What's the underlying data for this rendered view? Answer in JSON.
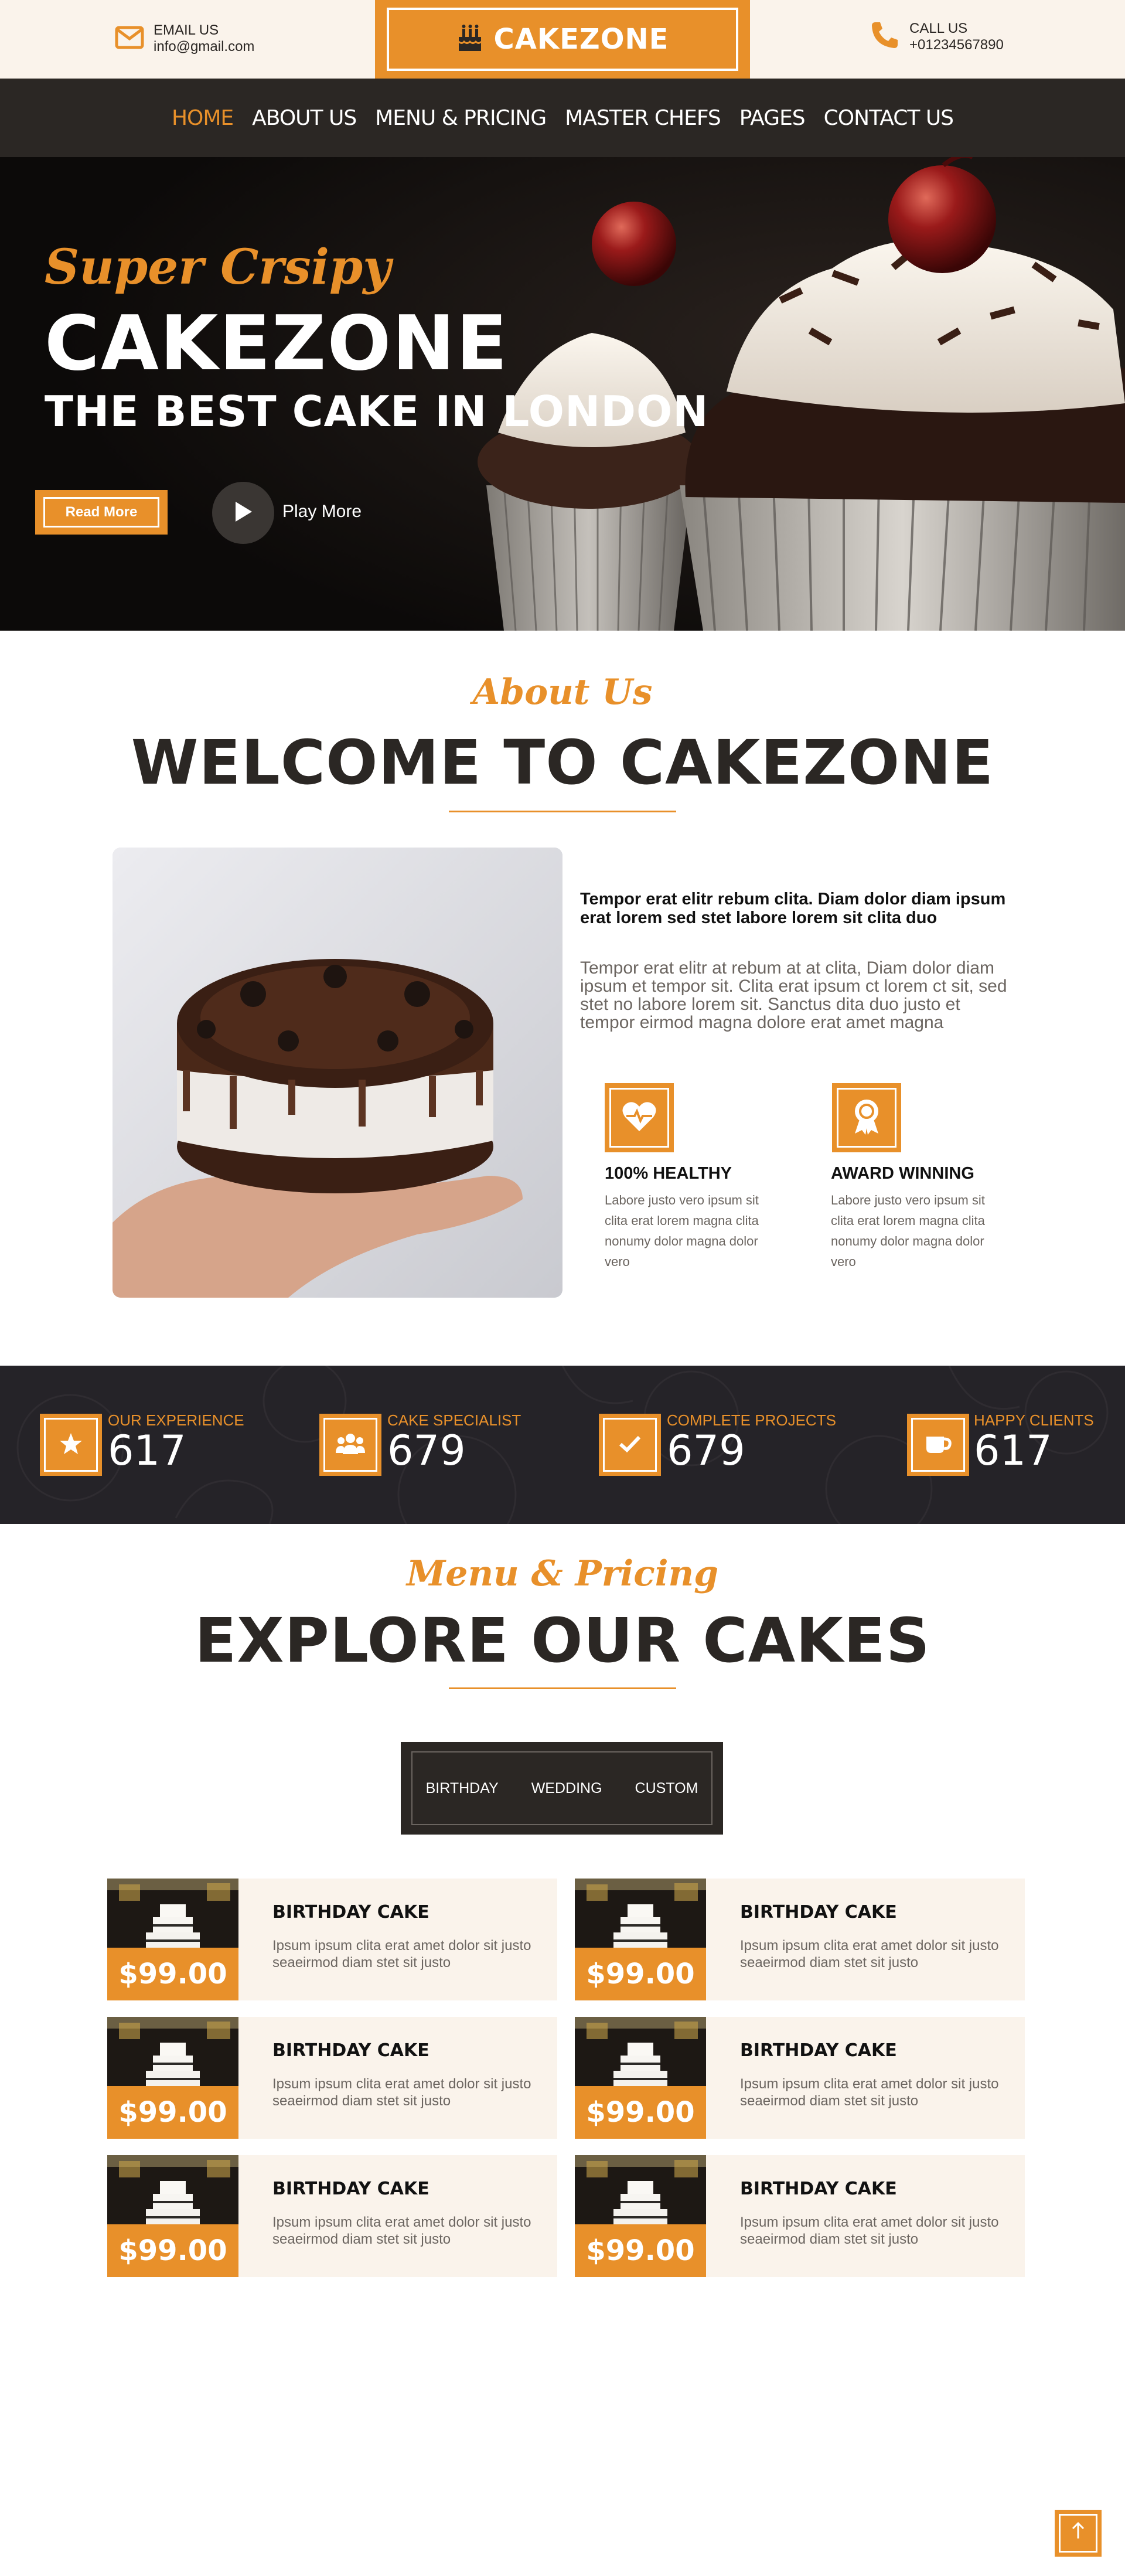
{
  "topbar": {
    "email_label": "EMAIL US",
    "email_value": "info@gmail.com",
    "call_label": "CALL US",
    "call_value": "+01234567890",
    "brand": "CAKEZONE"
  },
  "nav": {
    "items": [
      "HOME",
      "ABOUT US",
      "MENU & PRICING",
      "MASTER CHEFS",
      "PAGES",
      "CONTACT US"
    ],
    "active": "HOME"
  },
  "hero": {
    "subtitle": "Super Crsipy",
    "title": "CAKEZONE",
    "tagline": "THE BEST CAKE IN LONDON",
    "read_more": "Read More",
    "play_more": "Play More"
  },
  "about": {
    "script_title": "About Us",
    "title": "WELCOME TO CAKEZONE",
    "lead": "Tempor erat elitr rebum clita. Diam dolor diam ipsum erat lorem sed stet labore lorem sit clita duo",
    "text": "Tempor erat elitr at rebum at at clita, Diam dolor diam ipsum et tempor sit. Clita erat ipsum ct lorem ct sit, sed stet no labore lorem sit. Sanctus dita duo justo et tempor eirmod magna dolore erat amet magna",
    "features": [
      {
        "icon": "heart-pulse-icon",
        "title": "100% HEALTHY",
        "text": "Labore justo vero ipsum sit clita erat lorem magna clita nonumy dolor magna dolor vero"
      },
      {
        "icon": "award-icon",
        "title": "AWARD WINNING",
        "text": "Labore justo vero ipsum sit clita erat lorem magna clita nonumy dolor magna dolor vero"
      }
    ]
  },
  "stats": [
    {
      "icon": "star-icon",
      "label": "OUR EXPERIENCE",
      "value": "617"
    },
    {
      "icon": "users-icon",
      "label": "CAKE SPECIALIST",
      "value": "679"
    },
    {
      "icon": "check-icon",
      "label": "COMPLETE PROJECTS",
      "value": "679"
    },
    {
      "icon": "mug-icon",
      "label": "HAPPY CLIENTS",
      "value": "617"
    }
  ],
  "menu": {
    "script_title": "Menu & Pricing",
    "title": "EXPLORE OUR CAKES",
    "tabs": [
      "BIRTHDAY",
      "WEDDING",
      "CUSTOM"
    ],
    "items": [
      {
        "title": "BIRTHDAY CAKE",
        "price": "$99.00",
        "desc": "Ipsum ipsum clita erat amet dolor sit justo seaeirmod diam stet sit justo"
      },
      {
        "title": "BIRTHDAY CAKE",
        "price": "$99.00",
        "desc": "Ipsum ipsum clita erat amet dolor sit justo seaeirmod diam stet sit justo"
      },
      {
        "title": "BIRTHDAY CAKE",
        "price": "$99.00",
        "desc": "Ipsum ipsum clita erat amet dolor sit justo seaeirmod diam stet sit justo"
      },
      {
        "title": "BIRTHDAY CAKE",
        "price": "$99.00",
        "desc": "Ipsum ipsum clita erat amet dolor sit justo seaeirmod diam stet sit justo"
      },
      {
        "title": "BIRTHDAY CAKE",
        "price": "$99.00",
        "desc": "Ipsum ipsum clita erat amet dolor sit justo seaeirmod diam stet sit justo"
      },
      {
        "title": "BIRTHDAY CAKE",
        "price": "$99.00",
        "desc": "Ipsum ipsum clita erat amet dolor sit justo seaeirmod diam stet sit justo"
      }
    ]
  },
  "colors": {
    "accent": "#e8902a",
    "dark": "#2b2724",
    "cream": "#faf3eb"
  }
}
